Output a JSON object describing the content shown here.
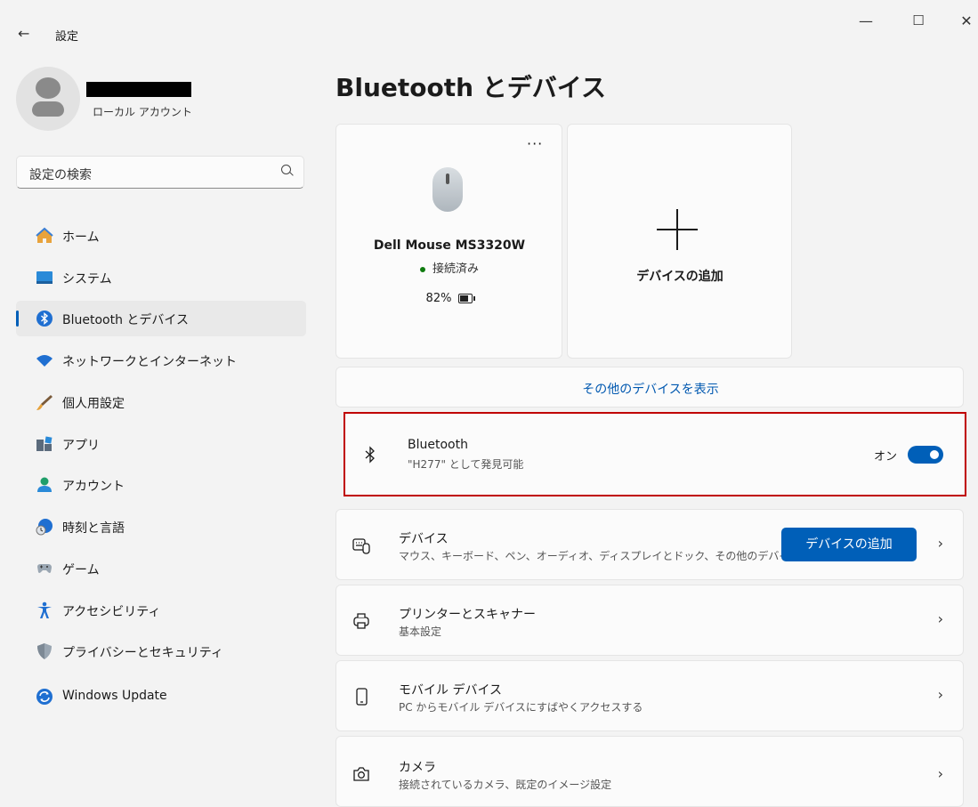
{
  "window": {
    "back_icon": "←",
    "title": "設定",
    "controls": {
      "minimize": "—",
      "maximize": "☐",
      "close": "✕"
    }
  },
  "profile": {
    "account_type": "ローカル アカウント"
  },
  "search": {
    "placeholder": "設定の検索"
  },
  "sidebar": {
    "items": [
      {
        "label": "ホーム",
        "icon": "home-icon"
      },
      {
        "label": "システム",
        "icon": "system-icon"
      },
      {
        "label": "Bluetooth とデバイス",
        "icon": "bluetooth-icon",
        "selected": true
      },
      {
        "label": "ネットワークとインターネット",
        "icon": "wifi-icon"
      },
      {
        "label": "個人用設定",
        "icon": "brush-icon"
      },
      {
        "label": "アプリ",
        "icon": "apps-icon"
      },
      {
        "label": "アカウント",
        "icon": "account-icon"
      },
      {
        "label": "時刻と言語",
        "icon": "globe-clock-icon"
      },
      {
        "label": "ゲーム",
        "icon": "gamepad-icon"
      },
      {
        "label": "アクセシビリティ",
        "icon": "accessibility-icon"
      },
      {
        "label": "プライバシーとセキュリティ",
        "icon": "shield-icon"
      },
      {
        "label": "Windows Update",
        "icon": "update-icon"
      }
    ]
  },
  "main": {
    "title": "Bluetooth とデバイス",
    "device_card": {
      "menu": "···",
      "name": "Dell Mouse MS3320W",
      "status": "接続済み",
      "battery": "82%",
      "battery_level": 0.82
    },
    "add_card": {
      "label": "デバイスの追加"
    },
    "more_devices": "その他のデバイスを表示",
    "bluetooth_row": {
      "title": "Bluetooth",
      "subtitle": "\"H277\" として発見可能",
      "toggle_label": "オン",
      "toggle_on": true
    },
    "devices_row": {
      "title": "デバイス",
      "subtitle": "マウス、キーボード、ペン、オーディオ、ディスプレイとドック、その他のデバイス",
      "button": "デバイスの追加"
    },
    "printers_row": {
      "title": "プリンターとスキャナー",
      "subtitle": "基本設定"
    },
    "mobile_row": {
      "title": "モバイル デバイス",
      "subtitle": "PC からモバイル デバイスにすばやくアクセスする"
    },
    "camera_row": {
      "title": "カメラ",
      "subtitle": "接続されているカメラ、既定のイメージ設定"
    },
    "chevron": "›",
    "accent_color": "#005fb8",
    "highlight_color": "#c00000"
  }
}
